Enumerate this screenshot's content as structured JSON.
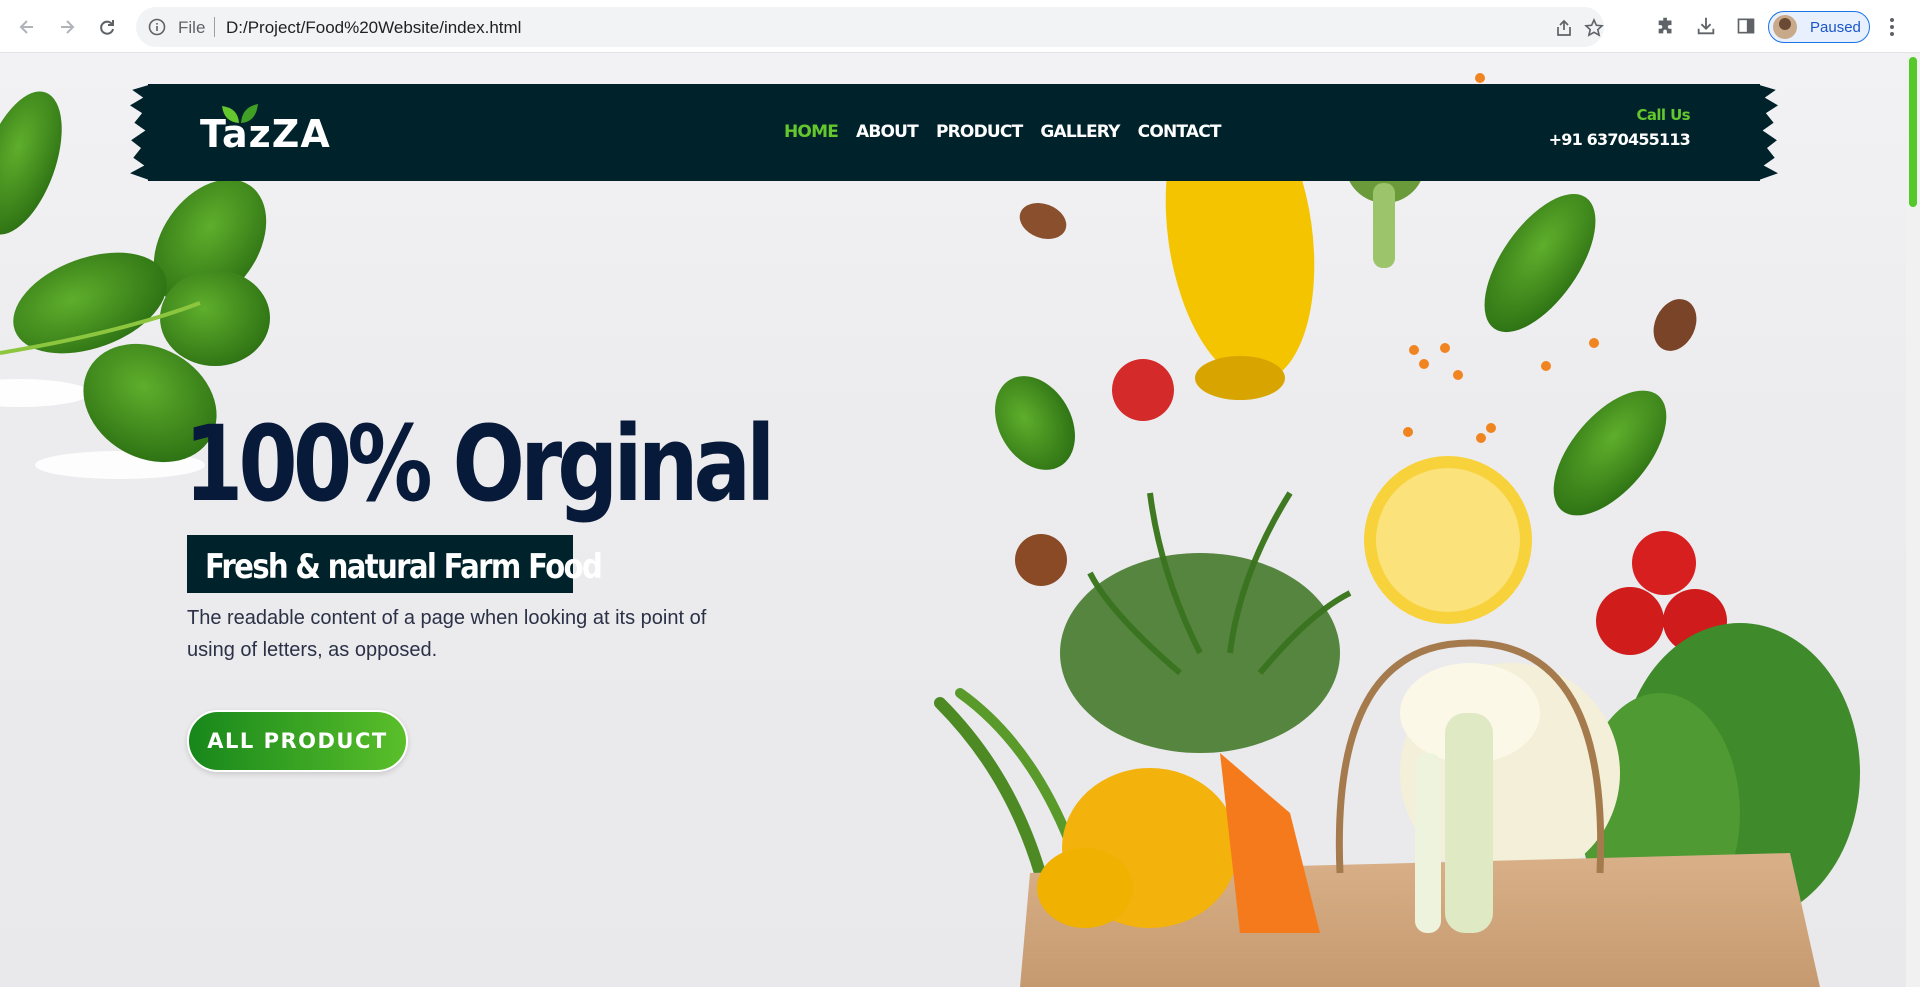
{
  "browser": {
    "file_label": "File",
    "url": "D:/Project/Food%20Website/index.html",
    "profile_status": "Paused",
    "icons": [
      "back-arrow-icon",
      "forward-arrow-icon",
      "reload-icon",
      "info-icon",
      "share-icon",
      "star-icon",
      "extensions-icon",
      "download-icon",
      "side-panel-icon",
      "avatar",
      "more-menu-icon"
    ]
  },
  "header": {
    "logo": "TazZA",
    "nav": [
      {
        "label": "HOME",
        "active": true
      },
      {
        "label": "ABOUT",
        "active": false
      },
      {
        "label": "PRODUCT",
        "active": false
      },
      {
        "label": "GALLERY",
        "active": false
      },
      {
        "label": "CONTACT",
        "active": false
      }
    ],
    "call_label": "Call Us",
    "phone": "+91 6370455113"
  },
  "hero": {
    "title": "100% Orginal",
    "subtitle": "Fresh & natural Farm Food",
    "description": "The readable content of a page when looking at its point of using of letters, as opposed.",
    "cta_label": "ALL PRODUCT"
  },
  "colors": {
    "header_bg": "#00222b",
    "accent_green": "#63c72d",
    "title_navy": "#081a3a",
    "button_start": "#17871b",
    "button_end": "#5abf2a"
  }
}
